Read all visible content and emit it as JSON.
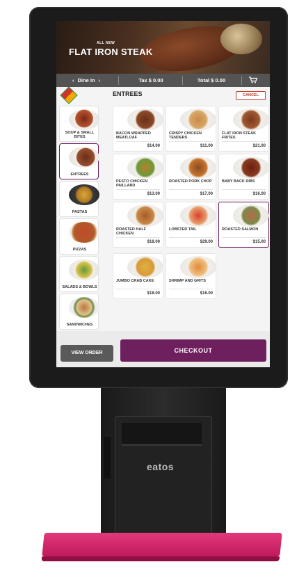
{
  "hero": {
    "small_label": "ALL NEW",
    "title": "FLAT IRON STEAK"
  },
  "top_bar": {
    "order_type": "Dine In",
    "tax": "Tax  $ 0.00",
    "total": "Total  $ 0.00",
    "prev_chevron": "‹",
    "next_chevron": "›"
  },
  "header": {
    "title": "ENTREES",
    "cancel_label": "CANCEL"
  },
  "categories": [
    {
      "label": "SOUP & SMALL BITES"
    },
    {
      "label": "ENTREES",
      "active": true
    },
    {
      "label": "PASTAS"
    },
    {
      "label": "PIZZAS"
    },
    {
      "label": "SALADS & BOWLS"
    },
    {
      "label": "SANDWICHES"
    }
  ],
  "items": [
    {
      "name": "BACON WRAPPED MEATLOAF",
      "price": "$14.00"
    },
    {
      "name": "CRISPY CHICKEN TENDERS",
      "price": "$11.00"
    },
    {
      "name": "FLAT IRON STEAK FRITES",
      "price": "$21.00"
    },
    {
      "name": "PESTO CHICKEN PAILLARD",
      "price": "$13.00"
    },
    {
      "name": "ROASTED PORK CHOP",
      "price": "$17.00"
    },
    {
      "name": "BABY BACK RIBS",
      "price": "$16.00"
    },
    {
      "name": "ROASTED HALF CHICKEN",
      "price": "$18.00"
    },
    {
      "name": "LOBSTER TAIL",
      "price": "$29.00"
    },
    {
      "name": "ROASTED SALMON",
      "price": "$15.00",
      "selected": true
    },
    {
      "name": "JUMBO CRAB CAKE",
      "price": "$18.00"
    },
    {
      "name": "SHRIMP AND GRITS",
      "price": "$16.00"
    }
  ],
  "footer": {
    "view_order_label": "VIEW ORDER",
    "checkout_label": "CHECKOUT"
  },
  "kiosk": {
    "brand": "eatos"
  },
  "colors": {
    "accent": "#6e1f5d",
    "cancel": "#c0392b",
    "bar": "#545454"
  }
}
